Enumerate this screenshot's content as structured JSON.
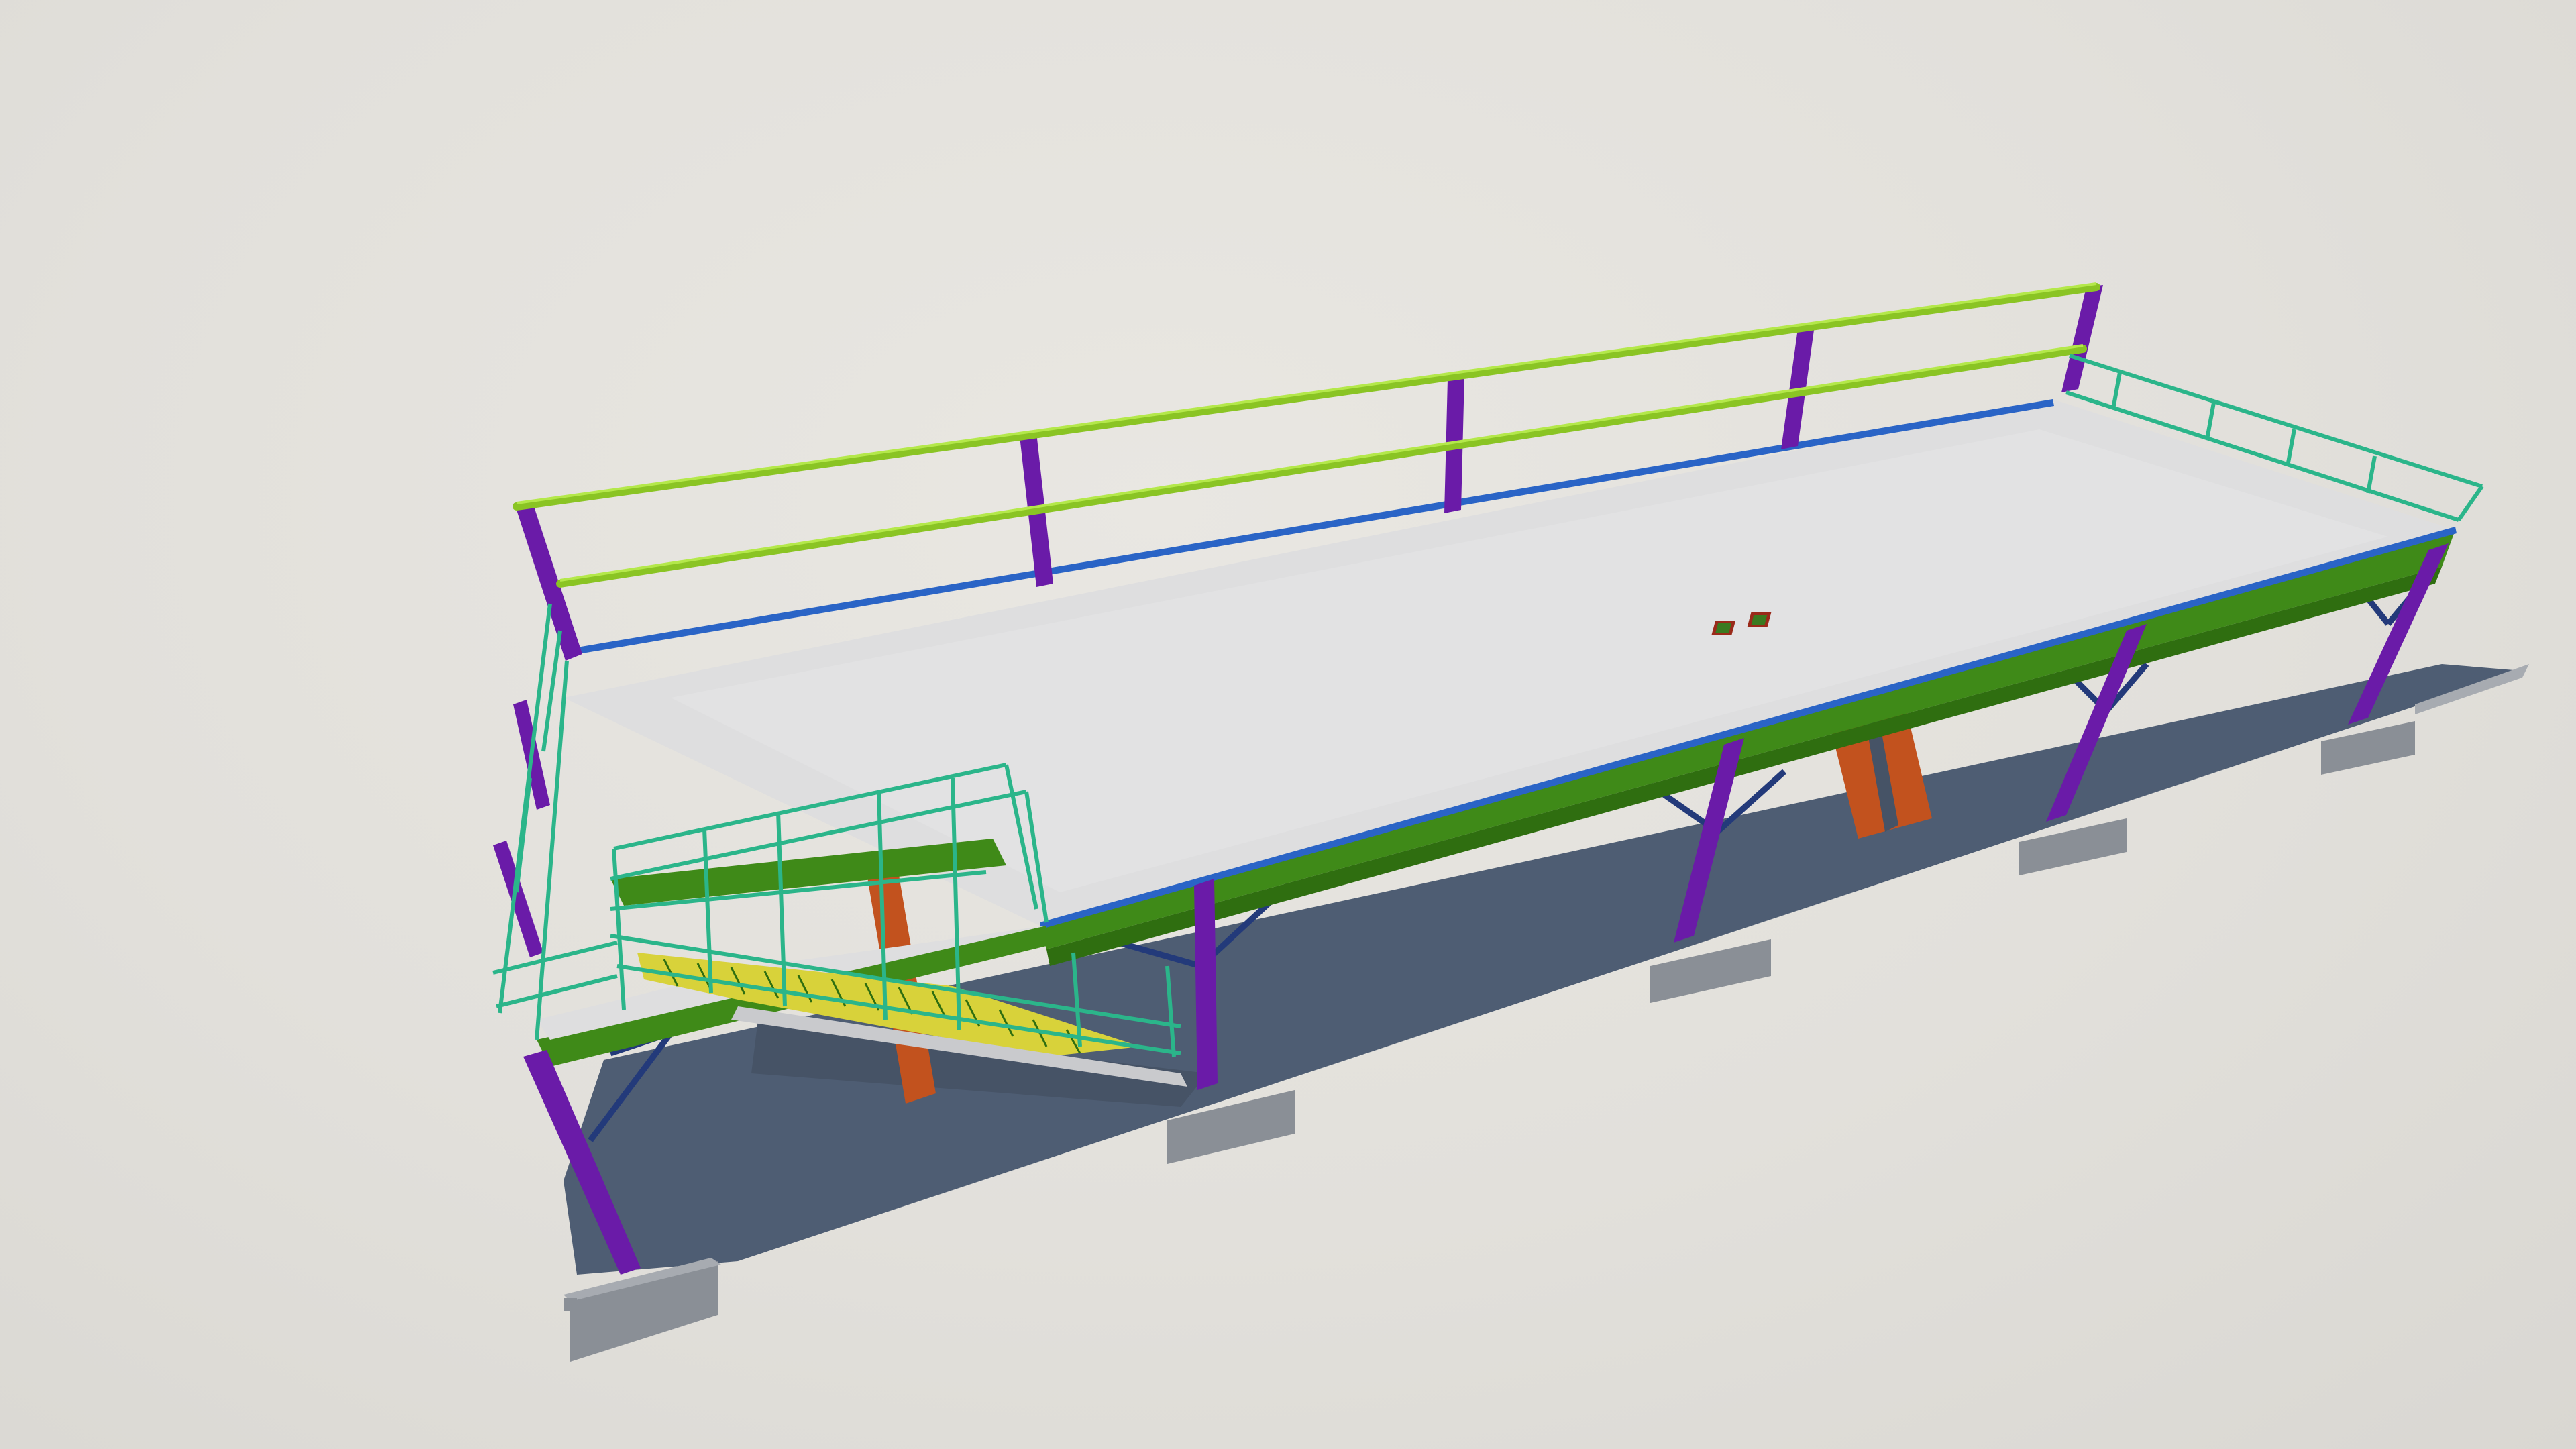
{
  "colors": {
    "background": "#e4e2dd",
    "ground_shadow": "#4e5d73",
    "ground_shadow_dark": "#465366",
    "deck_surface": "#dededf",
    "deck_surface_light": "#e4e4e6",
    "edge_beam_green": "#3f8a18",
    "edge_beam_green_dark": "#2f6e10",
    "edge_strip_blue": "#2a64c6",
    "column_purple": "#6a1ba8",
    "column_purple_light": "#8a35cc",
    "brace_navy": "#233a7a",
    "railing_lime": "#8ac424",
    "railing_lime_light": "#b4e84a",
    "railing_teal": "#2bb58a",
    "stair_yellow": "#d8d23a",
    "stair_orange_support": "#c2521e",
    "stair_stringer": "#c9cacd",
    "footing_gray": "#8a8f96",
    "footing_gray_top": "#a7abb1",
    "hatch_red": "#9a2a1a",
    "hatch_green": "#3a7a20"
  },
  "icons": {
    "deck_hatch_left": "square-hatch-icon",
    "deck_hatch_right": "square-hatch-icon"
  }
}
